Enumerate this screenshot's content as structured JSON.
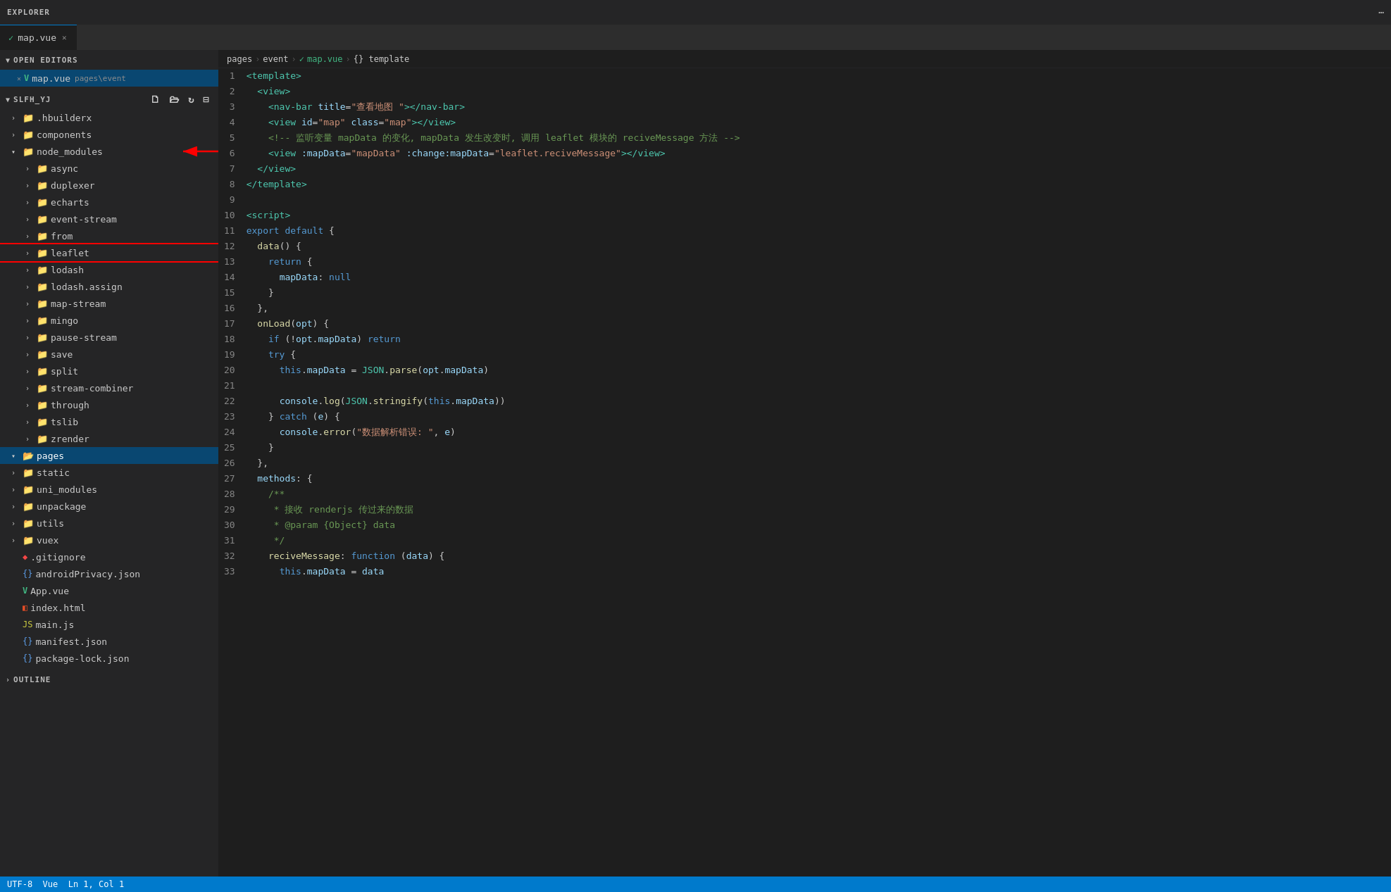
{
  "titleBar": {
    "explorerLabel": "EXPLORER",
    "moreIcon": "⋯"
  },
  "tabs": [
    {
      "id": "map-vue",
      "label": "map.vue",
      "path": "pages\\event",
      "active": true,
      "icon": "V"
    }
  ],
  "breadcrumb": {
    "items": [
      "pages",
      "event",
      "map.vue",
      "{} template"
    ]
  },
  "sidebar": {
    "openEditors": {
      "label": "OPEN EDITORS",
      "items": [
        {
          "label": "map.vue",
          "path": "pages\\event",
          "active": true
        }
      ]
    },
    "project": {
      "label": "SLFH_YJ",
      "items": [
        {
          "type": "folder",
          "label": ".hbuilderx",
          "level": 1,
          "expanded": false
        },
        {
          "type": "folder",
          "label": "components",
          "level": 1,
          "expanded": false
        },
        {
          "type": "folder",
          "label": "node_modules",
          "level": 1,
          "expanded": true,
          "annotated": true
        },
        {
          "type": "folder",
          "label": "async",
          "level": 2,
          "expanded": false
        },
        {
          "type": "folder",
          "label": "duplexer",
          "level": 2,
          "expanded": false
        },
        {
          "type": "folder",
          "label": "echarts",
          "level": 2,
          "expanded": false
        },
        {
          "type": "folder",
          "label": "event-stream",
          "level": 2,
          "expanded": false
        },
        {
          "type": "folder",
          "label": "from",
          "level": 2,
          "expanded": false
        },
        {
          "type": "folder",
          "label": "leaflet",
          "level": 2,
          "expanded": false,
          "highlighted": true
        },
        {
          "type": "folder",
          "label": "lodash",
          "level": 2,
          "expanded": false
        },
        {
          "type": "folder",
          "label": "lodash.assign",
          "level": 2,
          "expanded": false
        },
        {
          "type": "folder",
          "label": "map-stream",
          "level": 2,
          "expanded": false
        },
        {
          "type": "folder",
          "label": "mingo",
          "level": 2,
          "expanded": false
        },
        {
          "type": "folder",
          "label": "pause-stream",
          "level": 2,
          "expanded": false
        },
        {
          "type": "folder",
          "label": "save",
          "level": 2,
          "expanded": false
        },
        {
          "type": "folder",
          "label": "split",
          "level": 2,
          "expanded": false
        },
        {
          "type": "folder",
          "label": "stream-combiner",
          "level": 2,
          "expanded": false
        },
        {
          "type": "folder",
          "label": "through",
          "level": 2,
          "expanded": false
        },
        {
          "type": "folder",
          "label": "tslib",
          "level": 2,
          "expanded": false
        },
        {
          "type": "folder",
          "label": "zrender",
          "level": 2,
          "expanded": false
        },
        {
          "type": "folder",
          "label": "pages",
          "level": 1,
          "expanded": false,
          "active": true
        },
        {
          "type": "folder",
          "label": "static",
          "level": 1,
          "expanded": false
        },
        {
          "type": "folder",
          "label": "uni_modules",
          "level": 1,
          "expanded": false
        },
        {
          "type": "folder",
          "label": "unpackage",
          "level": 1,
          "expanded": false
        },
        {
          "type": "folder",
          "label": "utils",
          "level": 1,
          "expanded": false
        },
        {
          "type": "folder",
          "label": "vuex",
          "level": 1,
          "expanded": false
        },
        {
          "type": "file",
          "label": ".gitignore",
          "level": 1,
          "fileType": "git"
        },
        {
          "type": "file",
          "label": "androidPrivacy.json",
          "level": 1,
          "fileType": "json"
        },
        {
          "type": "file",
          "label": "App.vue",
          "level": 1,
          "fileType": "vue"
        },
        {
          "type": "file",
          "label": "index.html",
          "level": 1,
          "fileType": "html"
        },
        {
          "type": "file",
          "label": "main.js",
          "level": 1,
          "fileType": "js"
        },
        {
          "type": "file",
          "label": "manifest.json",
          "level": 1,
          "fileType": "json"
        },
        {
          "type": "file",
          "label": "package-lock.json",
          "level": 1,
          "fileType": "json"
        }
      ]
    },
    "outline": {
      "label": "OUTLINE"
    }
  },
  "code": {
    "lines": [
      {
        "num": 1,
        "content": "<template>"
      },
      {
        "num": 2,
        "content": "  <view>"
      },
      {
        "num": 3,
        "content": "    <nav-bar title=\"查看地图 \"></nav-bar>"
      },
      {
        "num": 4,
        "content": "    <view id=\"map\" class=\"map\"></view>"
      },
      {
        "num": 5,
        "content": "    <!-- 监听变量 mapData 的变化, mapData 发生改变时, 调用 leaflet 模块的 reciveMessage 方法 -->"
      },
      {
        "num": 6,
        "content": "    <view :mapData=\"mapData\" :change:mapData=\"leaflet.reciveMessage\"></view>"
      },
      {
        "num": 7,
        "content": "  </view>"
      },
      {
        "num": 8,
        "content": "</template>"
      },
      {
        "num": 9,
        "content": ""
      },
      {
        "num": 10,
        "content": "<script>"
      },
      {
        "num": 11,
        "content": "export default {"
      },
      {
        "num": 12,
        "content": "  data() {"
      },
      {
        "num": 13,
        "content": "    return {"
      },
      {
        "num": 14,
        "content": "      mapData: null"
      },
      {
        "num": 15,
        "content": "    }"
      },
      {
        "num": 16,
        "content": "  },"
      },
      {
        "num": 17,
        "content": "  onLoad(opt) {"
      },
      {
        "num": 18,
        "content": "    if (!opt.mapData) return"
      },
      {
        "num": 19,
        "content": "    try {"
      },
      {
        "num": 20,
        "content": "      this.mapData = JSON.parse(opt.mapData)"
      },
      {
        "num": 21,
        "content": ""
      },
      {
        "num": 22,
        "content": "      console.log(JSON.stringify(this.mapData))"
      },
      {
        "num": 23,
        "content": "    } catch (e) {"
      },
      {
        "num": 24,
        "content": "      console.error(\"数据解析错误: \", e)"
      },
      {
        "num": 25,
        "content": "    }"
      },
      {
        "num": 26,
        "content": "  },"
      },
      {
        "num": 27,
        "content": "  methods: {"
      },
      {
        "num": 28,
        "content": "    /**"
      },
      {
        "num": 29,
        "content": "     * 接收 renderjs 传过来的数据"
      },
      {
        "num": 30,
        "content": "     * @param {Object} data"
      },
      {
        "num": 31,
        "content": "     */"
      },
      {
        "num": 32,
        "content": "    reciveMessage: function (data) {"
      },
      {
        "num": 33,
        "content": "      this.mapData = data"
      }
    ]
  },
  "statusBar": {
    "info": "UTF-8  Vue  Ln 1, Col 1"
  }
}
